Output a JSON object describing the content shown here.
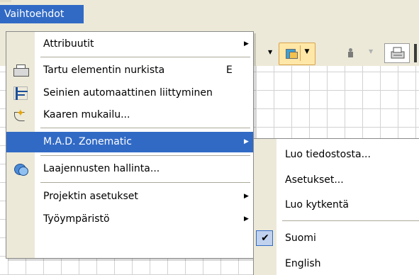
{
  "menubar": {
    "title": "Vaihtoehdot"
  },
  "main_menu": {
    "items": [
      {
        "label": "Attribuutit",
        "submenu": true,
        "icon": ""
      },
      {
        "label": "Tartu elementin nurkista",
        "shortcut": "E",
        "icon": "printer-snap-icon"
      },
      {
        "label": "Seinien automaattinen liittyminen",
        "icon": "wall-join-icon"
      },
      {
        "label": "Kaaren mukailu...",
        "icon": "arc-follow-icon"
      },
      {
        "label": "M.A.D. Zonematic",
        "submenu": true,
        "highlighted": true,
        "icon": ""
      },
      {
        "label": "Laajennusten hallinta...",
        "icon": "extensions-icon"
      },
      {
        "label": "Projektin asetukset",
        "submenu": true,
        "icon": ""
      },
      {
        "label": "Työympäristö",
        "submenu": true,
        "icon": ""
      }
    ],
    "submenu_arrow": "▶"
  },
  "sub_menu": {
    "items": [
      {
        "label": "Luo tiedostosta..."
      },
      {
        "label": "Asetukset..."
      },
      {
        "label": "Luo kytkentä"
      },
      {
        "label": "Suomi",
        "checked": true
      },
      {
        "label": "English"
      }
    ],
    "check_mark": "✔"
  },
  "toolbar": {
    "drop_arrow": "▼"
  },
  "colors": {
    "highlight": "#316ac5",
    "menu_gutter": "#ece9d8",
    "grid_line": "#d2d2d2"
  }
}
